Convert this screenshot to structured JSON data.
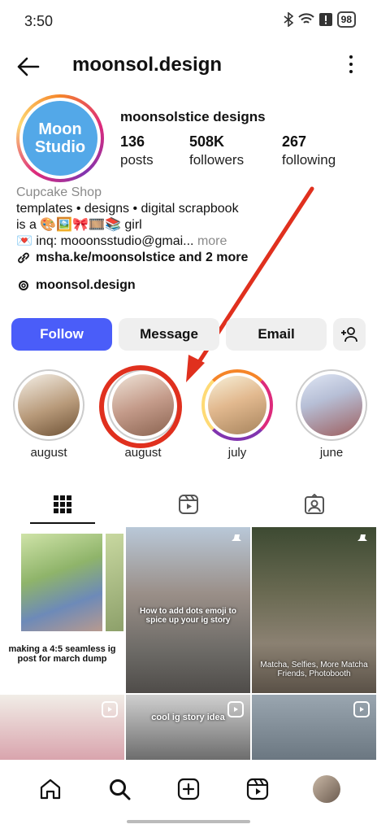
{
  "status": {
    "time": "3:50",
    "battery": "98"
  },
  "profile": {
    "username": "moonsol.design",
    "display_name": "moonsolstice designs",
    "avatar_text_line1": "Moon",
    "avatar_text_line2": "Studio",
    "stats": [
      {
        "num": "136",
        "label": "posts"
      },
      {
        "num": "508K",
        "label": "followers"
      },
      {
        "num": "267",
        "label": "following"
      }
    ],
    "category": "Cupcake Shop",
    "bio_line1": "templates • designs • digital scrapbook",
    "bio_line2": "is a 🎨🖼️🎀🎞️📚 girl",
    "bio_line3": "💌 inq: mooonsstudio@gmai...",
    "bio_more": "more",
    "link_text": "msha.ke/moonsolstice and 2 more",
    "threads_text": "moonsol.design"
  },
  "actions": {
    "follow": "Follow",
    "message": "Message",
    "email": "Email"
  },
  "highlights": [
    {
      "label": "august"
    },
    {
      "label": "august"
    },
    {
      "label": "july"
    },
    {
      "label": "june"
    }
  ],
  "posts": [
    {
      "caption": "making a 4:5 seamless ig post for march dump"
    },
    {
      "caption": "How to add dots emoji to spice up your ig story"
    },
    {
      "caption": "Matcha, Selfies, More Matcha Friends, Photobooth"
    },
    {
      "caption": ""
    },
    {
      "caption": "cool ig story idea"
    },
    {
      "caption": ""
    }
  ]
}
